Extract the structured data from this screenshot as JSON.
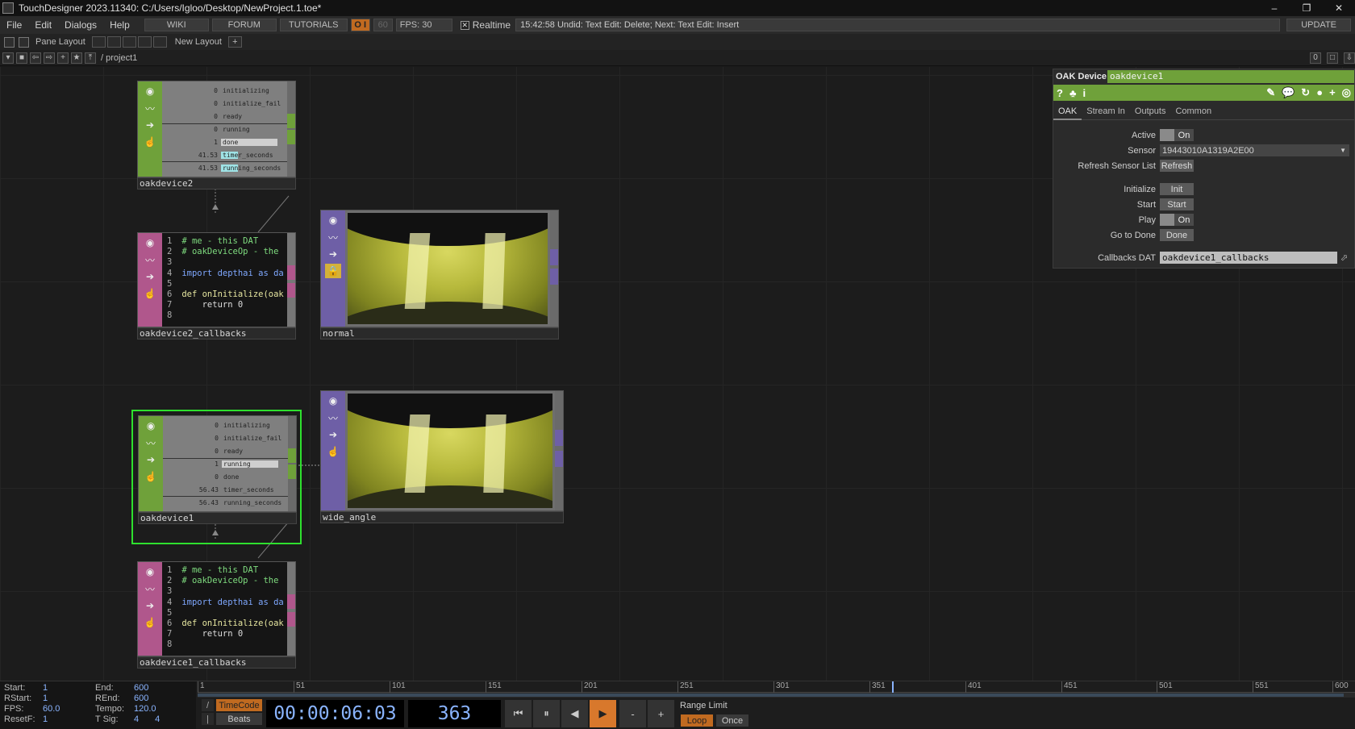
{
  "window": {
    "title": "TouchDesigner 2023.11340: C:/Users/Igloo/Desktop/NewProject.1.toe*",
    "controls": [
      "–",
      "❐",
      "✕"
    ]
  },
  "menubar": {
    "menus": [
      "File",
      "Edit",
      "Dialogs",
      "Help"
    ],
    "wiki": "WIKI",
    "forum": "FORUM",
    "tutorials": "TUTORIALS",
    "oi": "O I",
    "fps_cap": "60",
    "fps_label": "FPS:  30",
    "realtime_label": "Realtime",
    "realtime_checked": true,
    "undo_text": "15:42:58 Undid: Text Edit: Delete; Next: Text Edit: Insert",
    "update": "UPDATE"
  },
  "panebar": {
    "pane_layout": "Pane Layout",
    "new_layout": "New Layout"
  },
  "pathbar": {
    "path": "/ project1",
    "right_value": "0"
  },
  "nodes": {
    "oakdevice2": {
      "name": "oakdevice2",
      "channels": [
        {
          "value": "0",
          "name": "initializing"
        },
        {
          "value": "0",
          "name": "initialize_fail"
        },
        {
          "value": "0",
          "name": "ready"
        },
        {
          "value": "0",
          "name": "running"
        },
        {
          "value": "1",
          "name": "done"
        },
        {
          "value": "41.53",
          "name": "timer_seconds"
        },
        {
          "value": "41.53",
          "name": "running_seconds"
        }
      ]
    },
    "oakdevice1": {
      "name": "oakdevice1",
      "channels": [
        {
          "value": "0",
          "name": "initializing"
        },
        {
          "value": "0",
          "name": "initialize_fail"
        },
        {
          "value": "0",
          "name": "ready"
        },
        {
          "value": "1",
          "name": "running"
        },
        {
          "value": "0",
          "name": "done"
        },
        {
          "value": "56.43",
          "name": "timer_seconds"
        },
        {
          "value": "56.43",
          "name": "running_seconds"
        }
      ]
    },
    "callbacks2": {
      "name": "oakdevice2_callbacks",
      "code": [
        {
          "n": "1",
          "t": "# me - this DAT"
        },
        {
          "n": "2",
          "t": "# oakDeviceOp - the"
        },
        {
          "n": "3",
          "t": ""
        },
        {
          "n": "4",
          "t": "import depthai as da"
        },
        {
          "n": "5",
          "t": ""
        },
        {
          "n": "6",
          "t": "def onInitialize(oak"
        },
        {
          "n": "7",
          "t": "    return 0"
        },
        {
          "n": "8",
          "t": ""
        }
      ]
    },
    "callbacks1": {
      "name": "oakdevice1_callbacks",
      "code": [
        {
          "n": "1",
          "t": "# me - this DAT"
        },
        {
          "n": "2",
          "t": "# oakDeviceOp - the"
        },
        {
          "n": "3",
          "t": ""
        },
        {
          "n": "4",
          "t": "import depthai as da"
        },
        {
          "n": "5",
          "t": ""
        },
        {
          "n": "6",
          "t": "def onInitialize(oak"
        },
        {
          "n": "7",
          "t": "    return 0"
        },
        {
          "n": "8",
          "t": ""
        }
      ]
    },
    "normal": {
      "name": "normal"
    },
    "wide_angle": {
      "name": "wide_angle"
    }
  },
  "params": {
    "op_type": "OAK Device",
    "op_name": "oakdevice1",
    "tabs": [
      "OAK",
      "Stream In",
      "Outputs",
      "Common"
    ],
    "active_tab": "OAK",
    "active_label": "Active",
    "active_value": "On",
    "sensor_label": "Sensor",
    "sensor_value": "19443010A1319A2E00",
    "refresh_label": "Refresh Sensor List",
    "refresh_btn": "Refresh",
    "initialize_label": "Initialize",
    "initialize_btn": "Init",
    "start_label": "Start",
    "start_btn": "Start",
    "play_label": "Play",
    "play_value": "On",
    "done_label": "Go to Done",
    "done_btn": "Done",
    "callbacks_label": "Callbacks DAT",
    "callbacks_value": "oakdevice1_callbacks"
  },
  "timeline": {
    "start_label": "Start:",
    "start": "1",
    "end_label": "End:",
    "end": "600",
    "rstart_label": "RStart:",
    "rstart": "1",
    "rend_label": "REnd:",
    "rend": "600",
    "fps_label": "FPS:",
    "fps": "60.0",
    "tempo_label": "Tempo:",
    "tempo": "120.0",
    "resetf_label": "ResetF:",
    "resetf": "1",
    "tsig_label": "T Sig:",
    "tsig_a": "4",
    "tsig_b": "4",
    "ticks": [
      "1",
      "51",
      "101",
      "151",
      "201",
      "251",
      "301",
      "351",
      "401",
      "451",
      "501",
      "551",
      "600"
    ],
    "timecode_btn": "TimeCode",
    "beats_btn": "Beats",
    "timecode": "00:00:06:03",
    "frame": "363",
    "range_limit": "Range Limit",
    "loop": "Loop",
    "once": "Once",
    "current_frame": 363,
    "range_end": 600
  }
}
